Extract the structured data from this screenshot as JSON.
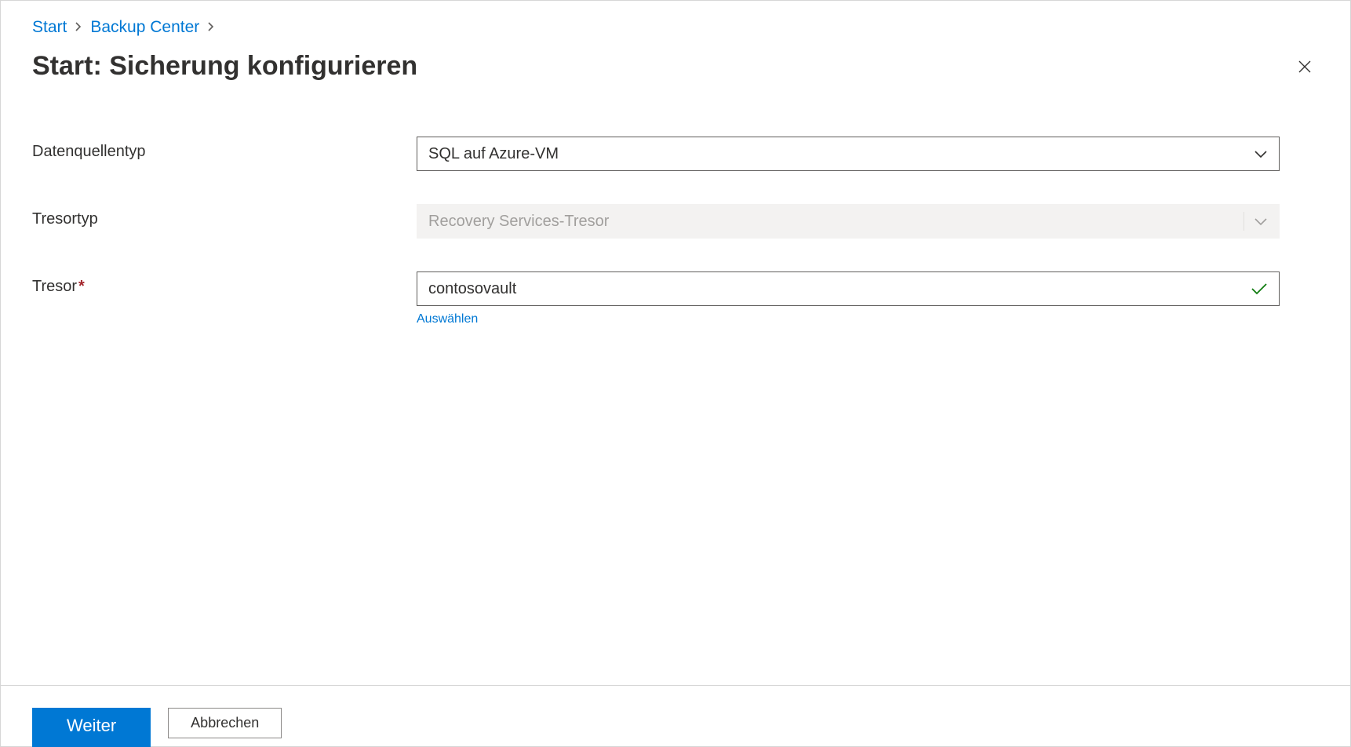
{
  "breadcrumb": {
    "items": [
      {
        "label": "Start"
      },
      {
        "label": "Backup Center"
      }
    ]
  },
  "page": {
    "title": "Start: Sicherung konfigurieren"
  },
  "form": {
    "datasourceType": {
      "label": "Datenquellentyp",
      "value": "SQL auf Azure-VM"
    },
    "vaultType": {
      "label": "Tresortyp",
      "value": "Recovery Services-Tresor"
    },
    "vault": {
      "label": "Tresor",
      "value": "contosovault",
      "selectLink": "Auswählen"
    }
  },
  "footer": {
    "next": "Weiter",
    "cancel": "Abbrechen"
  }
}
